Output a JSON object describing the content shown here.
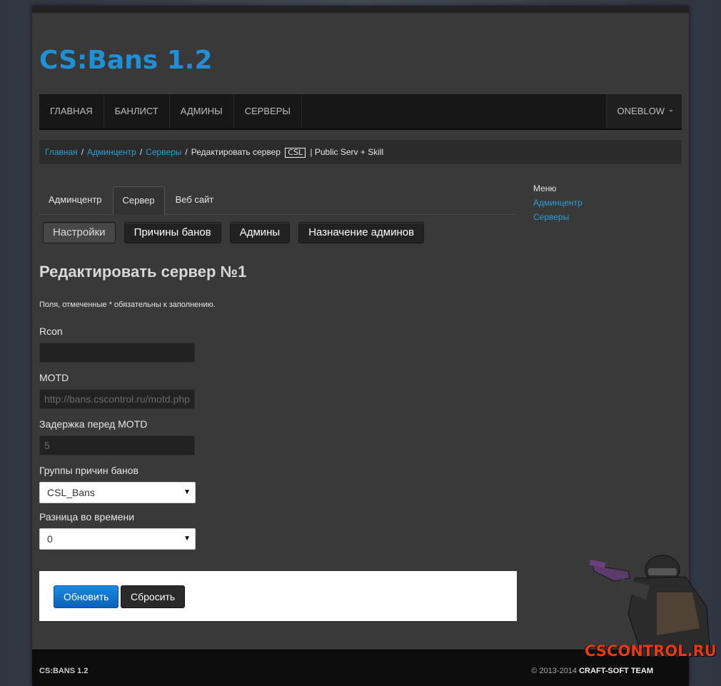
{
  "site": {
    "logo": "CS:Bans 1.2"
  },
  "nav": {
    "items": [
      "Главная",
      "Банлист",
      "Админы",
      "Серверы"
    ],
    "user": "ONEBLOW"
  },
  "breadcrumb": {
    "items": [
      "Главная",
      "Админцентр",
      "Серверы"
    ],
    "current_prefix": "Редактировать сервер",
    "tag": "CSL",
    "current_suffix": "| Public Serv + Skill"
  },
  "tabs": [
    "Админцентр",
    "Сервер",
    "Веб сайт"
  ],
  "subnav": [
    "Настройки",
    "Причины банов",
    "Админы",
    "Назначение админов"
  ],
  "form": {
    "title": "Редактировать сервер №1",
    "note": "Поля, отмеченные * обязательны к заполнению.",
    "rcon_label": "Rcon",
    "rcon_value": "",
    "motd_label": "MOTD",
    "motd_value": "http://bans.cscontrol.ru/motd.php",
    "delay_label": "Задержка перед MOTD",
    "delay_value": "5",
    "groups_label": "Группы причин банов",
    "groups_value": "CSL_Bans",
    "time_label": "Разница во времени",
    "time_value": "0",
    "update_btn": "Обновить",
    "reset_btn": "Сбросить"
  },
  "sidebar": {
    "head": "Меню",
    "links": [
      "Админцентр",
      "Серверы"
    ]
  },
  "footer": {
    "brand": "CS:BANS 1.2",
    "copy": "© 2013-2014",
    "team": "CRAFT-SOFT TEAM"
  },
  "watermark": "CSCONTROL.RU",
  "colors": {
    "accent": "#2a9fd6",
    "logo": "#1f8fd6",
    "primary": "#0a62b8"
  }
}
